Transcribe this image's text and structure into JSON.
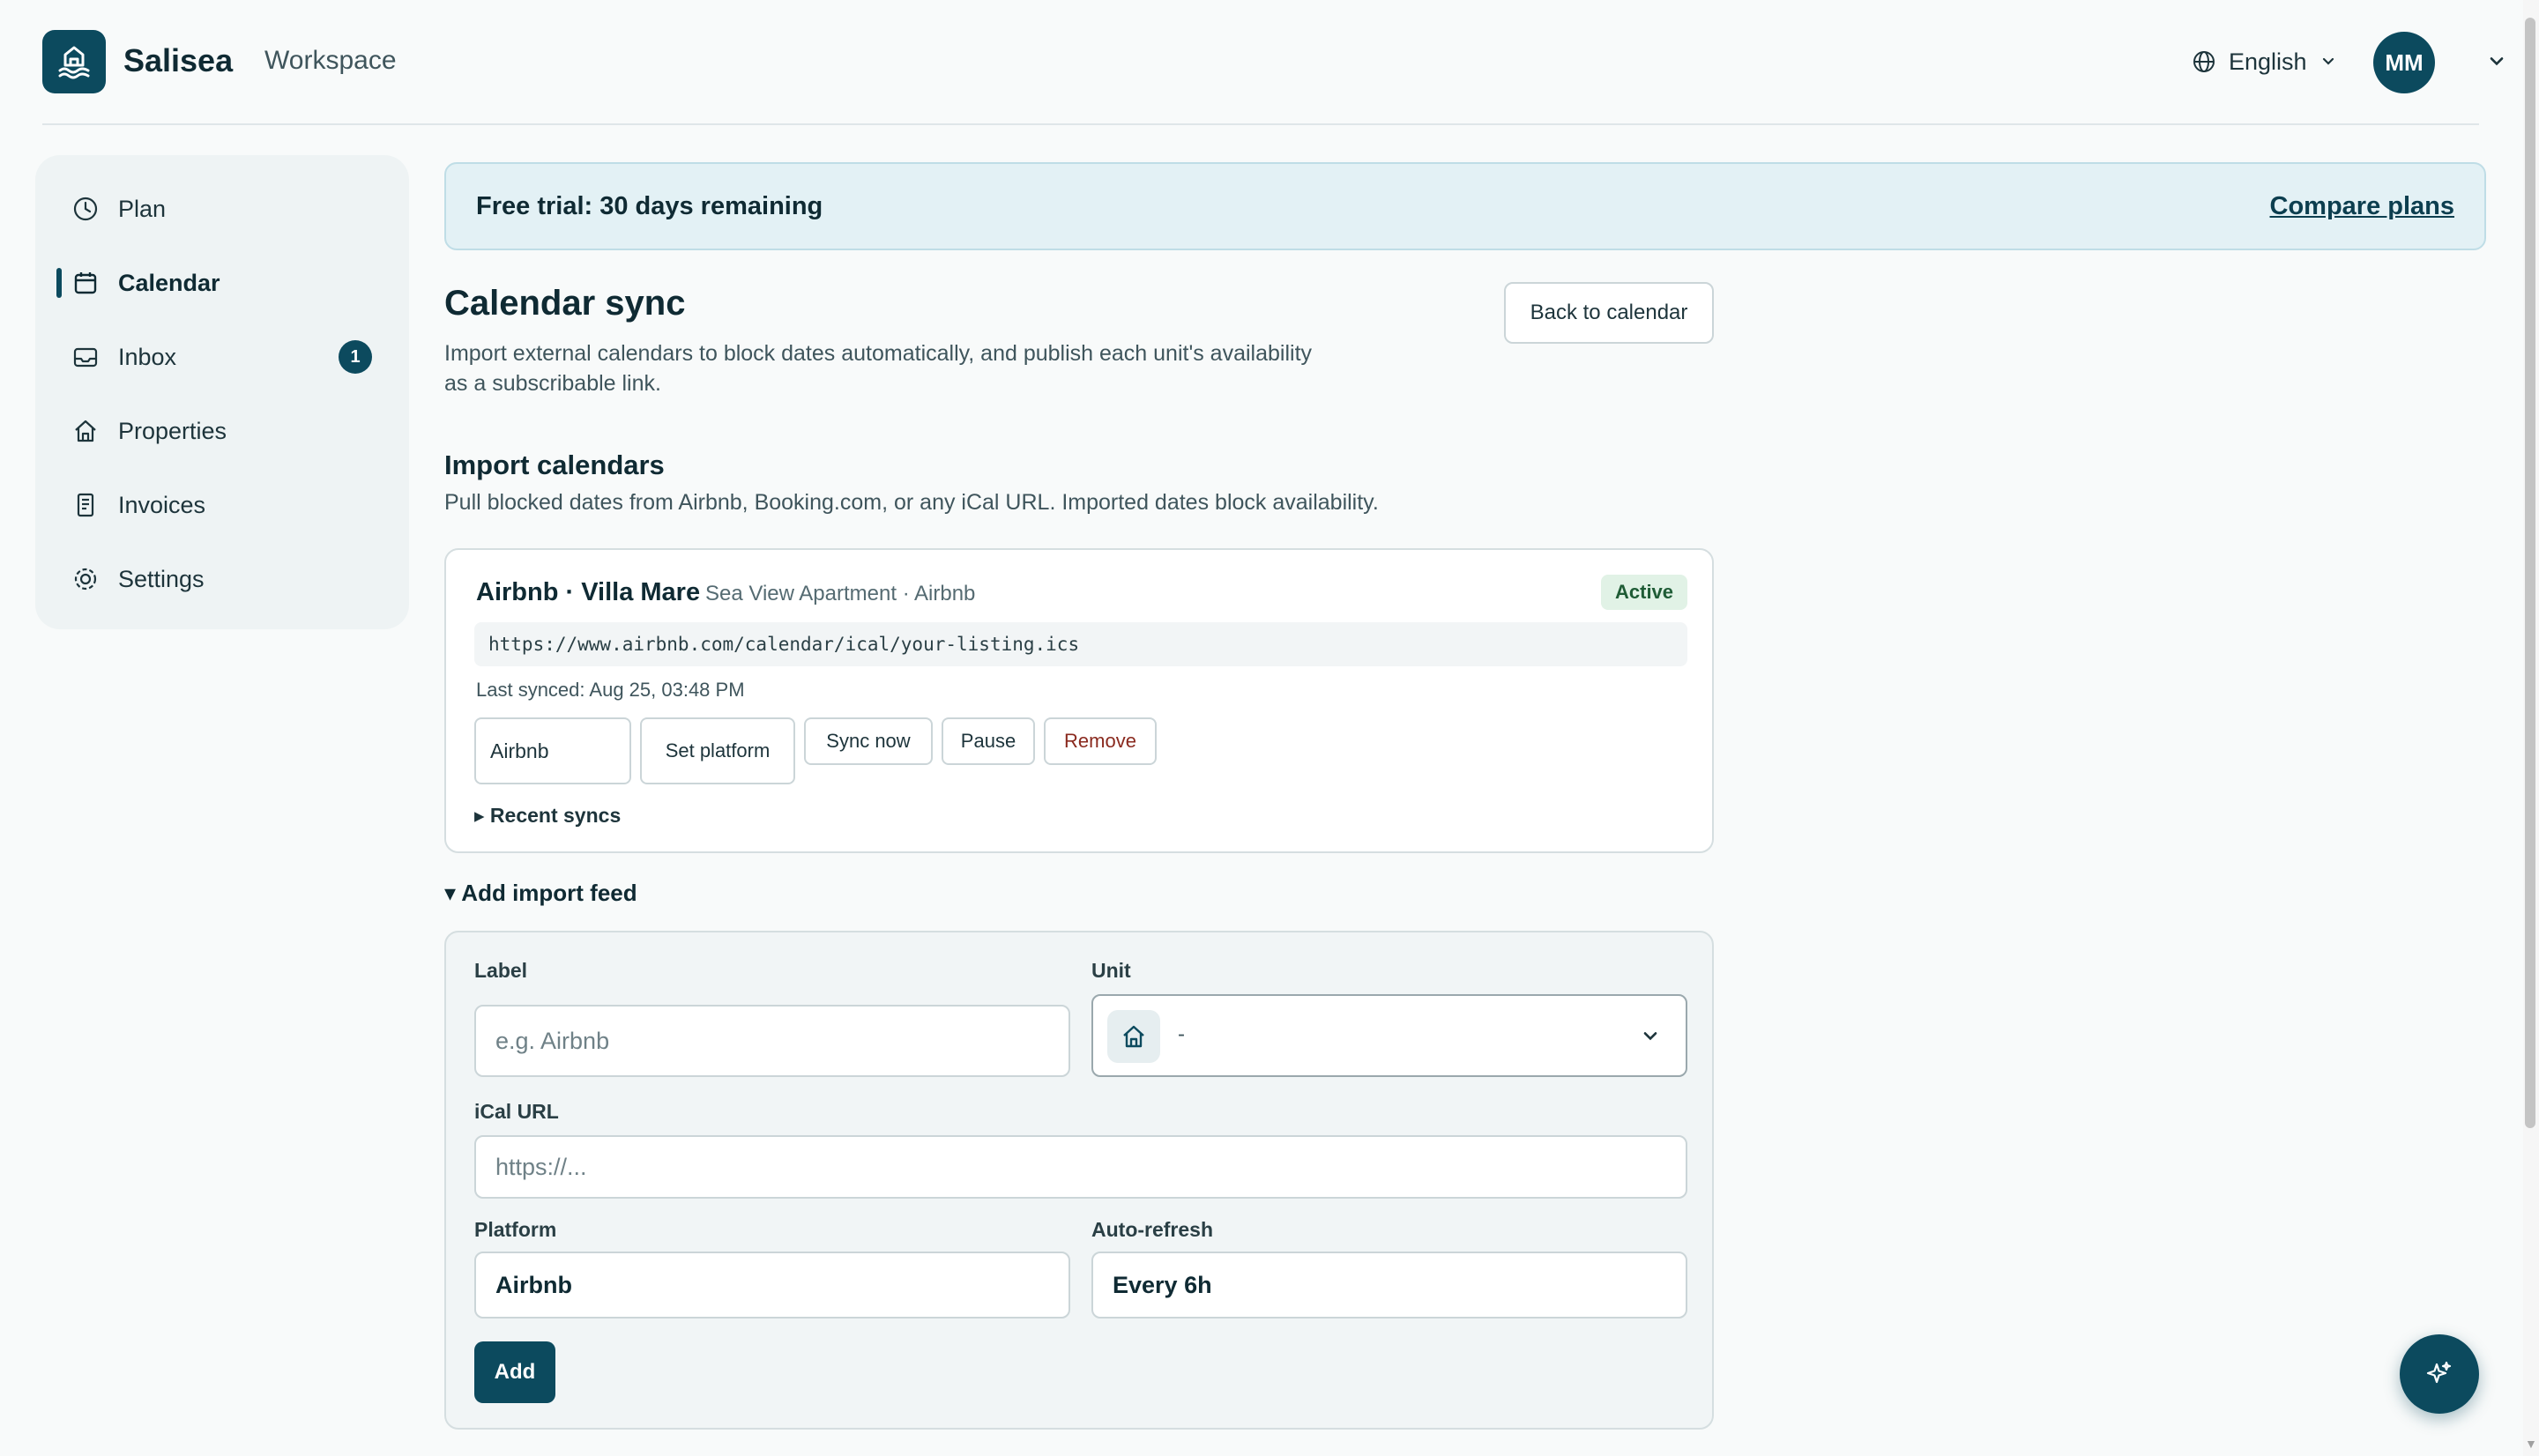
{
  "header": {
    "brand": "Salisea",
    "workspace": "Workspace",
    "language": "English",
    "avatar_initials": "MM"
  },
  "sidebar": {
    "items": [
      {
        "label": "Plan",
        "icon": "clock-icon"
      },
      {
        "label": "Calendar",
        "icon": "calendar-icon",
        "active": true
      },
      {
        "label": "Inbox",
        "icon": "inbox-icon",
        "badge": "1"
      },
      {
        "label": "Properties",
        "icon": "home-icon"
      },
      {
        "label": "Invoices",
        "icon": "receipt-icon"
      },
      {
        "label": "Settings",
        "icon": "gear-icon"
      }
    ]
  },
  "trial": {
    "text": "Free trial: 30 days remaining",
    "link": "Compare plans"
  },
  "page": {
    "title": "Calendar sync",
    "description": "Import external calendars to block dates automatically, and publish each unit's availability as a subscribable link.",
    "back_button": "Back to calendar"
  },
  "import": {
    "title": "Import calendars",
    "description": "Pull blocked dates from Airbnb, Booking.com, or any iCal URL. Imported dates block availability."
  },
  "feed": {
    "name": "Airbnb · Villa Mare",
    "subtitle": "Sea View Apartment · Airbnb",
    "status": "Active",
    "url": "https://www.airbnb.com/calendar/ical/your-listing.ics",
    "last_synced": "Last synced: Aug 25, 03:48 PM",
    "platform_value": "Airbnb",
    "set_platform": "Set platform",
    "sync_now": "Sync now",
    "pause": "Pause",
    "remove": "Remove",
    "recent_syncs": "▸ Recent syncs"
  },
  "add_feed": {
    "toggle": "▾ Add import feed",
    "label_label": "Label",
    "label_placeholder": "e.g. Airbnb",
    "unit_label": "Unit",
    "unit_value": "-",
    "url_label": "iCal URL",
    "url_placeholder": "https://...",
    "platform_label": "Platform",
    "platform_value": "Airbnb",
    "refresh_label": "Auto-refresh",
    "refresh_value": "Every 6h",
    "add_button": "Add"
  },
  "colors": {
    "primary": "#0c4a5e",
    "banner_bg": "#e3f1f5",
    "status_bg": "#e1f2e6",
    "remove_text": "#8a2a1f"
  }
}
